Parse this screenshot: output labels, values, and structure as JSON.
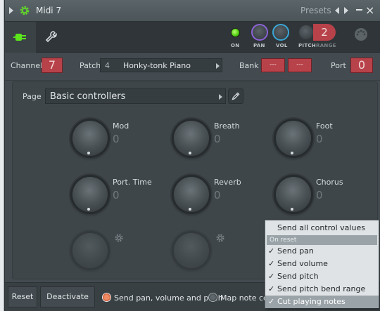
{
  "window": {
    "title": "Midi 7",
    "presets_label": "Presets",
    "minimize": "–",
    "close": "×"
  },
  "toolbar": {
    "on_label": "ON",
    "pan_label": "PAN",
    "vol_label": "VOL",
    "pitch_label": "PITCH",
    "range_label": "RANGE",
    "range_value": "2",
    "on_led_color": "#4dcc12",
    "pan_ring_color": "#8c63d6",
    "vol_ring_color": "#3aa6d6"
  },
  "channel_row": {
    "channel_label": "Channel",
    "channel_value": "7",
    "patch_label": "Patch",
    "patch_number": "4",
    "patch_name": "Honky-tonk Piano",
    "bank_label": "Bank",
    "bank_value_1": "---",
    "bank_value_2": "---",
    "port_label": "Port",
    "port_value": "0"
  },
  "page": {
    "label": "Page",
    "value": "Basic controllers"
  },
  "controllers": [
    {
      "name": "Mod",
      "value": "0"
    },
    {
      "name": "Breath",
      "value": "0"
    },
    {
      "name": "Foot",
      "value": "0"
    },
    {
      "name": "Port. Time",
      "value": "0"
    },
    {
      "name": "Reverb",
      "value": "0"
    },
    {
      "name": "Chorus",
      "value": "0"
    }
  ],
  "bottom": {
    "reset": "Reset",
    "deactivate_all": "Deactivate all",
    "send_pan_volume_pitch": "Send pan, volume and pitch",
    "map_note_color": "Map note colo"
  },
  "context_menu": {
    "send_all": "Send all control values now",
    "on_reset_header": "On reset",
    "items": [
      {
        "label": "Send pan",
        "checked": "✓"
      },
      {
        "label": "Send volume",
        "checked": "✓"
      },
      {
        "label": "Send pitch",
        "checked": "✓"
      },
      {
        "label": "Send pitch bend range",
        "checked": "✓"
      },
      {
        "label": "Cut playing notes",
        "checked": "✓"
      }
    ]
  },
  "colors": {
    "accent_red": "#b8424a",
    "plug_green": "#5ce61c",
    "radio_active": "#f08a62"
  }
}
